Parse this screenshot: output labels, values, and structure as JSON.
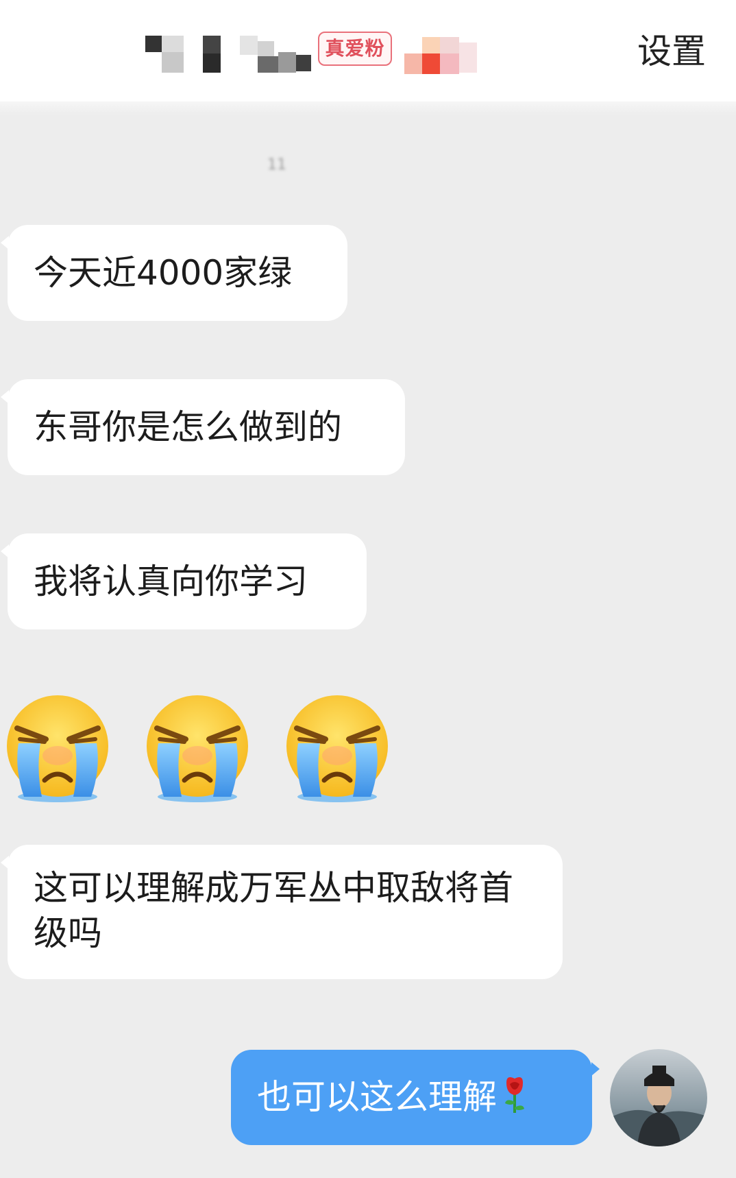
{
  "header": {
    "badge_label": "真爱粉",
    "settings_label": "设置"
  },
  "timestamp": "11",
  "messages": {
    "incoming": [
      "今天近4000家绿",
      "东哥你是怎么做到的",
      "我将认真向你学习",
      "这可以理解成万军丛中取敌将首级吗"
    ],
    "emoji_reaction": {
      "icon": "loudly-crying-face-icon",
      "count": 3
    },
    "outgoing": {
      "text": "也可以这么理解",
      "trailing_icon": "rose-icon"
    }
  },
  "colors": {
    "background": "#ededed",
    "incoming_bubble": "#ffffff",
    "outgoing_bubble": "#4da0f5",
    "badge": "#e0505c"
  }
}
